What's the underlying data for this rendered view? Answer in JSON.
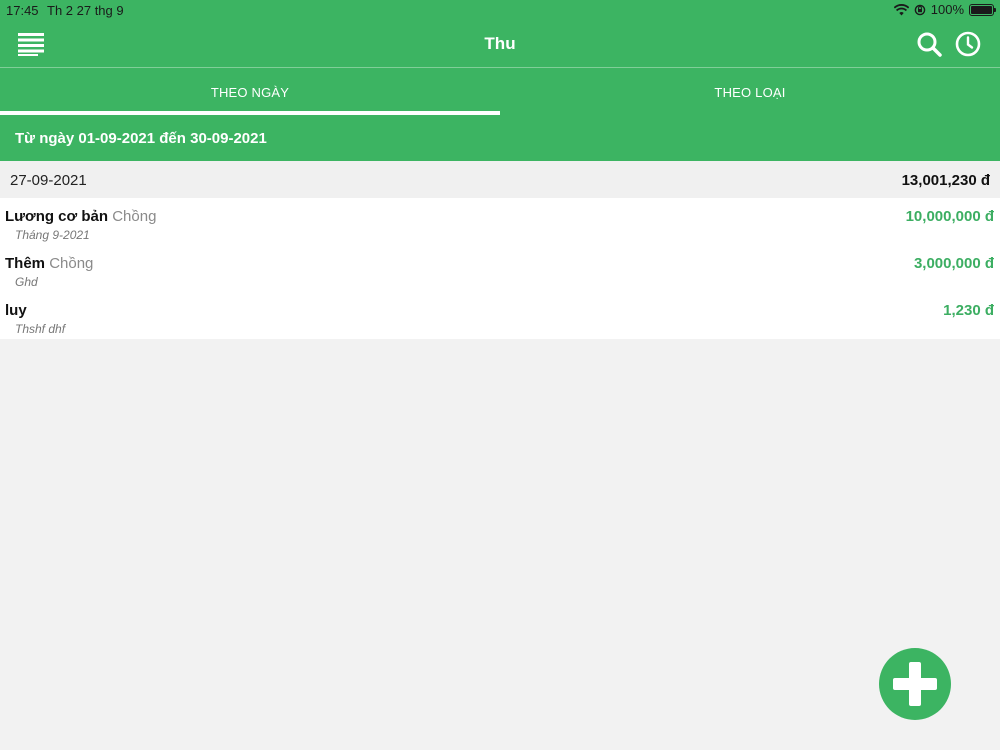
{
  "status_bar": {
    "time": "17:45",
    "date": "Th 2 27 thg 9",
    "battery": "100%"
  },
  "navbar": {
    "title": "Thu"
  },
  "tabs": [
    {
      "label": "THEO NGÀY",
      "active": true
    },
    {
      "label": "THEO LOẠI",
      "active": false
    }
  ],
  "range": "Từ ngày 01-09-2021 đến 30-09-2021",
  "group": {
    "date": "27-09-2021",
    "total": "13,001,230 đ",
    "items": [
      {
        "name": "Lương cơ bản",
        "who": "Chồng",
        "note": "Tháng 9-2021",
        "amount": "10,000,000 đ"
      },
      {
        "name": "Thêm",
        "who": "Chồng",
        "note": "Ghd",
        "amount": "3,000,000 đ"
      },
      {
        "name": "luy",
        "who": "",
        "note": "Thshf dhf",
        "amount": "1,230 đ"
      }
    ]
  },
  "colors": {
    "brand_green": "#3cb462",
    "amount_green": "#3cae62"
  },
  "icons": [
    "menu-icon",
    "search-icon",
    "clock-icon",
    "wifi-icon",
    "rotation-lock-icon",
    "battery-icon",
    "plus-icon"
  ]
}
